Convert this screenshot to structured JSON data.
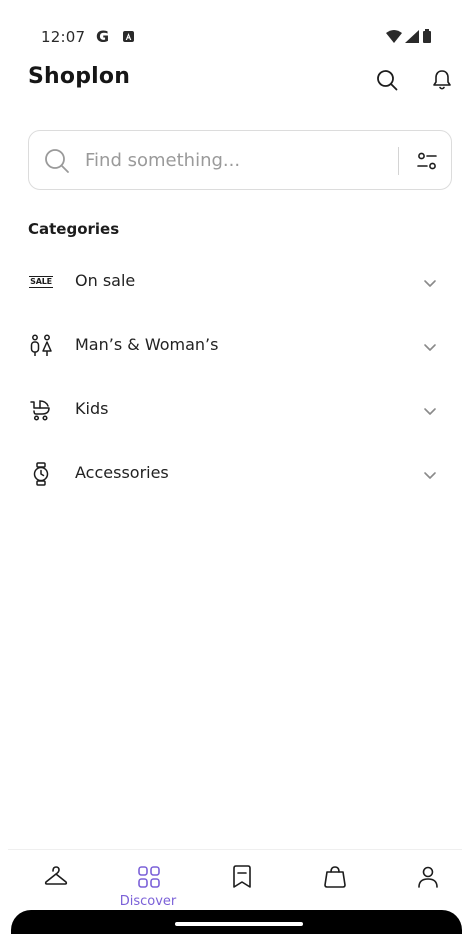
{
  "status_bar": {
    "time": "12:07",
    "g_badge": "G"
  },
  "header": {
    "title": "Shoplon"
  },
  "search": {
    "placeholder": "Find something..."
  },
  "categories": {
    "title": "Categories",
    "items": [
      {
        "label": "On sale",
        "icon": "sale-tag-icon"
      },
      {
        "label": "Man’s & Woman’s",
        "icon": "man-woman-icon"
      },
      {
        "label": "Kids",
        "icon": "stroller-icon"
      },
      {
        "label": "Accessories",
        "icon": "watch-icon"
      }
    ]
  },
  "sale_icon_text": "SALE",
  "bottom_nav": {
    "active": "Discover",
    "items": [
      {
        "icon": "hanger-icon"
      },
      {
        "label": "Discover",
        "icon": "grid-icon"
      },
      {
        "icon": "bookmark-icon"
      },
      {
        "icon": "shopping-bag-icon"
      },
      {
        "icon": "profile-icon"
      }
    ]
  },
  "colors": {
    "accent": "#7b61d8",
    "text": "#1c1c1c",
    "muted": "#9a9a9a",
    "border": "#dcdcdc"
  }
}
